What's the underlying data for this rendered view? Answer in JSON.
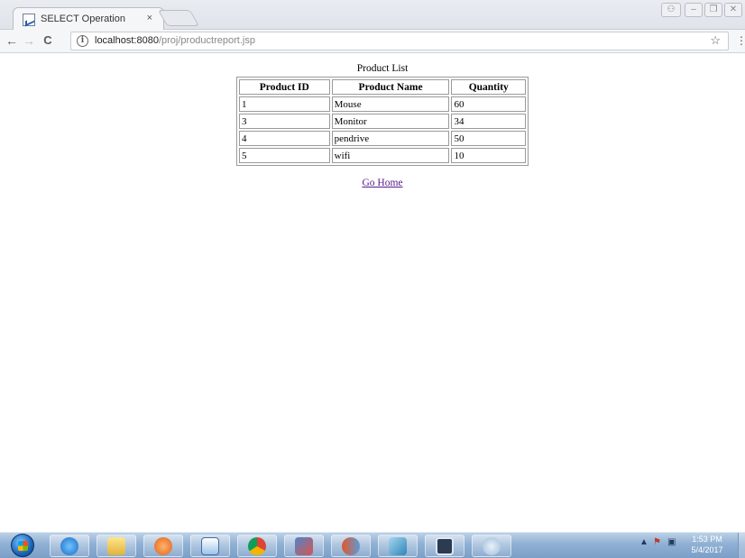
{
  "browser": {
    "tab_title": "SELECT Operation",
    "tab_close": "×",
    "url_host": "localhost:8080",
    "url_path": "/proj/productreport.jsp",
    "info_glyph": "i",
    "star_glyph": "☆",
    "menu_glyph": "⋮",
    "back_glyph": "←",
    "forward_glyph": "→",
    "reload_glyph": "C"
  },
  "page": {
    "caption": "Product List",
    "columns": [
      "Product ID",
      "Product Name",
      "Quantity"
    ],
    "rows": [
      [
        "1",
        "Mouse",
        "60"
      ],
      [
        "3",
        "Monitor",
        "34"
      ],
      [
        "4",
        "pendrive",
        "50"
      ],
      [
        "5",
        "wifi",
        "10"
      ]
    ],
    "home_link": "Go Home",
    "link_color": "#551a8b"
  },
  "taskbar": {
    "clock_time": "1:53 PM",
    "clock_date": "5/4/2017",
    "apps": [
      "internet-explorer-icon",
      "file-explorer-icon",
      "media-player-icon",
      "word-pad-icon",
      "chrome-icon",
      "paint-icon",
      "app-icon",
      "app-icon",
      "window-icon",
      "network-icon"
    ]
  }
}
